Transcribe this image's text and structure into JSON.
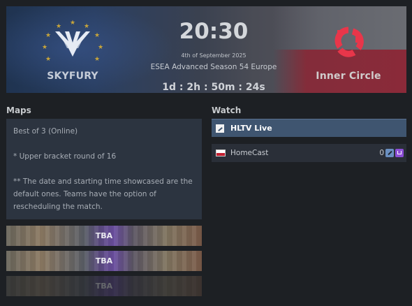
{
  "match": {
    "time": "20:30",
    "date": "4th of September 2025",
    "event": "ESEA Advanced Season 54 Europe",
    "countdown": "1d : 2h : 50m : 24s"
  },
  "teams": {
    "left": {
      "name": "SKYFURY",
      "logo_icon": "skyfury-wings-logo",
      "flag_icon": "eu-stars-icon"
    },
    "right": {
      "name": "Inner Circle",
      "logo_icon": "inner-circle-logo",
      "accent": "#e8364a"
    }
  },
  "maps": {
    "title": "Maps",
    "info": [
      "Best of 3 (Online)",
      "* Upper bracket round of 16",
      "** The date and starting time showcased are the default ones. Teams have the option of rescheduling the match."
    ],
    "rows": [
      {
        "label": "TBA"
      },
      {
        "label": "TBA"
      },
      {
        "label": "TBA"
      }
    ]
  },
  "watch": {
    "title": "Watch",
    "streams": [
      {
        "label": "HLTV Live",
        "icon": "hltv-icon"
      },
      {
        "label": "HomeCast",
        "flag": "poland-flag-icon",
        "viewers": "0",
        "icons": [
          "external-link-icon",
          "twitch-icon"
        ]
      }
    ]
  },
  "colors": {
    "background": "#1d2024",
    "panel": "#2c3440",
    "live_highlight": "#3f5570",
    "twitch": "#8d4fd6"
  }
}
